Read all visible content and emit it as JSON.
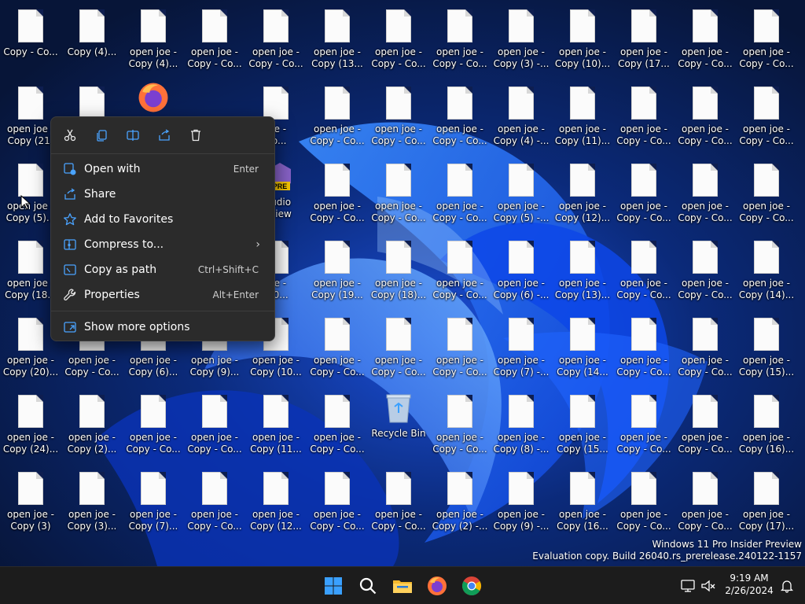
{
  "desktop_rows": [
    [
      "Copy - Co...",
      "Copy (4)...",
      "open joe -\nCopy (4)...",
      "open joe -\nCopy - Co...",
      "open joe -\nCopy - Co...",
      "open joe -\nCopy (13...",
      "open joe -\nCopy - Co...",
      "open joe -\nCopy - Co...",
      "open joe -\nCopy (3) -...",
      "open joe -\nCopy (10)...",
      "open joe -\nCopy (17...",
      "open joe -\nCopy - Co...",
      "open joe -\nCopy - Co..."
    ],
    [
      "open joe -\nCopy (21)",
      "",
      "",
      "",
      "joe -\nCo...",
      "open joe -\nCopy - Co...",
      "open joe -\nCopy - Co...",
      "open joe -\nCopy - Co...",
      "open joe -\nCopy (4) -...",
      "open joe -\nCopy (11)...",
      "open joe -\nCopy - Co...",
      "open joe -\nCopy - Co...",
      "open joe -\nCopy - Co..."
    ],
    [
      "open joe -\nCopy (5)...",
      "",
      "",
      "",
      "Studio\nreview",
      "open joe -\nCopy - Co...",
      "open joe -\nCopy - Co...",
      "open joe -\nCopy - Co...",
      "open joe -\nCopy (5) -...",
      "open joe -\nCopy (12)...",
      "open joe -\nCopy - Co...",
      "open joe -\nCopy - Co...",
      "open joe -\nCopy - Co..."
    ],
    [
      "open joe -\nCopy (18...",
      "",
      "",
      "",
      "joe -\n(20...",
      "open joe -\nCopy (19...",
      "open joe -\nCopy (18)...",
      "open joe -\nCopy - Co...",
      "open joe -\nCopy (6) -...",
      "open joe -\nCopy (13)...",
      "open joe -\nCopy - Co...",
      "open joe -\nCopy - Co...",
      "open joe -\nCopy (14)..."
    ],
    [
      "open joe -\nCopy (20)...",
      "open joe -\nCopy - Co...",
      "open joe -\nCopy (6)...",
      "open joe -\nCopy (9)...",
      "open joe -\nCopy (10...",
      "open joe -\nCopy - Co...",
      "open joe -\nCopy - Co...",
      "open joe -\nCopy - Co...",
      "open joe -\nCopy (7) -...",
      "open joe -\nCopy (14...",
      "open joe -\nCopy - Co...",
      "open joe -\nCopy - Co...",
      "open joe -\nCopy (15)..."
    ],
    [
      "open joe -\nCopy (24)...",
      "open joe -\nCopy (2)...",
      "open joe -\nCopy - Co...",
      "open joe -\nCopy - Co...",
      "open joe -\nCopy (11...",
      "open joe -\nCopy - Co...",
      "Recycle Bin",
      "open joe -\nCopy - Co...",
      "open joe -\nCopy (8) -...",
      "open joe -\nCopy (15...",
      "open joe -\nCopy - Co...",
      "open joe -\nCopy - Co...",
      "open joe -\nCopy (16)..."
    ],
    [
      "open joe -\nCopy (3)",
      "open joe -\nCopy (3)...",
      "open joe -\nCopy (7)...",
      "open joe -\nCopy - Co...",
      "open joe -\nCopy (12...",
      "open joe -\nCopy - Co...",
      "open joe -\nCopy - Co...",
      "open joe -\nCopy (2) -...",
      "open joe -\nCopy (9) -...",
      "open joe -\nCopy (16...",
      "open joe -\nCopy - Co...",
      "open joe -\nCopy - Co...",
      "open joe -\nCopy (17)..."
    ]
  ],
  "context_menu": {
    "quick_actions": [
      {
        "name": "cut-icon"
      },
      {
        "name": "copy-icon"
      },
      {
        "name": "rename-icon"
      },
      {
        "name": "share-icon"
      },
      {
        "name": "delete-icon"
      }
    ],
    "items": [
      {
        "label": "Open with",
        "shortcut": "Enter",
        "icon": "open-with-icon"
      },
      {
        "label": "Share",
        "shortcut": "",
        "icon": "share-icon"
      },
      {
        "label": "Add to Favorites",
        "shortcut": "",
        "icon": "star-icon"
      },
      {
        "label": "Compress to...",
        "shortcut": "",
        "icon": "zip-icon",
        "submenu": true
      },
      {
        "label": "Copy as path",
        "shortcut": "Ctrl+Shift+C",
        "icon": "copy-path-icon"
      },
      {
        "label": "Properties",
        "shortcut": "Alt+Enter",
        "icon": "wrench-icon"
      }
    ],
    "more_options": {
      "label": "Show more options",
      "icon": "more-options-icon"
    }
  },
  "watermark": {
    "line1": "Windows 11 Pro Insider Preview",
    "line2": "Evaluation copy. Build 26040.rs_prerelease.240122-1157"
  },
  "taskbar": {
    "apps": [
      {
        "name": "start-button",
        "icon": "windows-logo-icon"
      },
      {
        "name": "search-button",
        "icon": "search-icon"
      },
      {
        "name": "file-explorer-button",
        "icon": "folder-icon"
      },
      {
        "name": "firefox-button",
        "icon": "firefox-icon"
      },
      {
        "name": "chrome-button",
        "icon": "chrome-icon"
      }
    ],
    "clock": {
      "time": "9:19 AM",
      "date": "2/26/2024"
    }
  },
  "colors": {
    "accent": "#0078d4",
    "menu_bg": "#2b2b2b",
    "taskbar_bg": "#1c1c1c"
  }
}
